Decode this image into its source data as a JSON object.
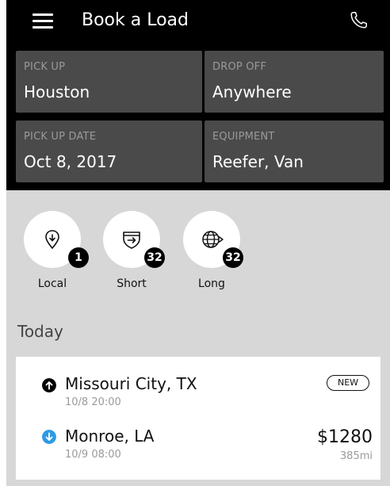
{
  "header": {
    "title": "Book a Load"
  },
  "filters": {
    "pickup": {
      "label": "PICK UP",
      "value": "Houston"
    },
    "dropoff": {
      "label": "DROP OFF",
      "value": "Anywhere"
    },
    "pickup_date": {
      "label": "PICK UP DATE",
      "value": "Oct 8, 2017"
    },
    "equipment": {
      "label": "EQUIPMENT",
      "value": "Reefer, Van"
    }
  },
  "categories": [
    {
      "label": "Local",
      "count": "1",
      "icon": "location-pin-icon"
    },
    {
      "label": "Short",
      "count": "32",
      "icon": "highway-sign-icon"
    },
    {
      "label": "Long",
      "count": "32",
      "icon": "globe-icon"
    }
  ],
  "section": {
    "title": "Today"
  },
  "loads": [
    {
      "origin": {
        "city": "Missouri City, TX",
        "time": "10/8 20:00"
      },
      "destination": {
        "city": "Monroe, LA",
        "time": "10/9 08:00"
      },
      "badge": "NEW",
      "price": "$1280",
      "distance": "385mi"
    }
  ],
  "colors": {
    "header_bg": "#000000",
    "card_bg": "#4a4a4a",
    "page_bg": "#d7d7d7",
    "dropoff_accent": "#2e9be6"
  }
}
